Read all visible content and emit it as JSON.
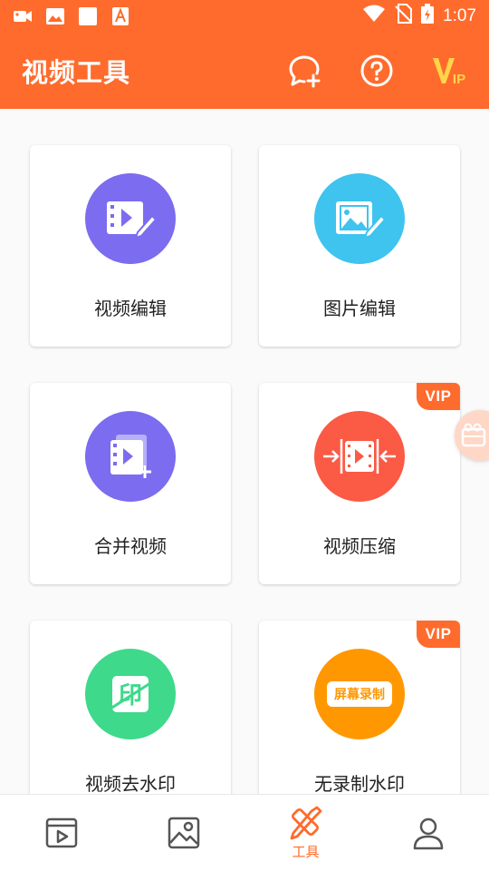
{
  "status_bar": {
    "time": "1:07",
    "left_icons": [
      "video-camera-icon",
      "image-icon",
      "blank-square-icon",
      "a-badge-icon"
    ],
    "right_icons": [
      "wifi-icon",
      "no-sim-icon",
      "battery-charging-icon"
    ]
  },
  "appbar": {
    "title": "视频工具",
    "actions": [
      "chat-add-icon",
      "help-icon",
      "vip-icon"
    ],
    "vip_text": "IP"
  },
  "tools": [
    {
      "label": "视频编辑",
      "color": "#7b6cf0",
      "icon": "video-edit-icon",
      "vip": false
    },
    {
      "label": "图片编辑",
      "color": "#3fc3ef",
      "icon": "image-edit-icon",
      "vip": false
    },
    {
      "label": "合并视频",
      "color": "#7b6cf0",
      "icon": "merge-video-icon",
      "vip": false
    },
    {
      "label": "视频压缩",
      "color": "#fb5a45",
      "icon": "compress-video-icon",
      "vip": true
    },
    {
      "label": "视频去水印",
      "color": "#3ed98b",
      "icon": "remove-watermark-icon",
      "vip": false,
      "icon_text": "印"
    },
    {
      "label": "无录制水印",
      "color": "#ff9800",
      "icon": "screen-record-icon",
      "vip": true,
      "icon_text": "屏幕录制"
    }
  ],
  "vip_badge": "VIP",
  "bottom_nav": [
    {
      "name": "video",
      "icon": "video-tab-icon",
      "label": ""
    },
    {
      "name": "image",
      "icon": "image-tab-icon",
      "label": ""
    },
    {
      "name": "tools",
      "icon": "tools-tab-icon",
      "label": "工具",
      "active": true
    },
    {
      "name": "profile",
      "icon": "profile-tab-icon",
      "label": ""
    }
  ],
  "colors": {
    "accent": "#ff6b2c"
  }
}
